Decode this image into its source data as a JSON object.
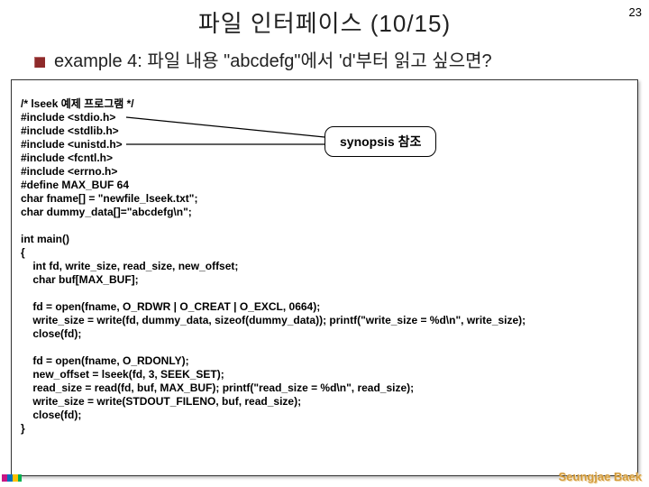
{
  "page": {
    "title": "파일 인터페이스 (10/15)",
    "number": "23",
    "subtitle": "example 4: 파일 내용 \"abcdefg\"에서 'd'부터 읽고 싶으면?"
  },
  "code": {
    "block1": "/* lseek 예제 프로그램 */\n#include <stdio.h>\n#include <stdlib.h>\n#include <unistd.h>\n#include <fcntl.h>\n#include <errno.h>\n#define MAX_BUF 64\nchar fname[] = \"newfile_lseek.txt\";\nchar dummy_data[]=\"abcdefg\\n\";",
    "block2": "int main()\n{\n    int fd, write_size, read_size, new_offset;\n    char buf[MAX_BUF];",
    "block3": "    fd = open(fname, O_RDWR | O_CREAT | O_EXCL, 0664);\n    write_size = write(fd, dummy_data, sizeof(dummy_data)); printf(\"write_size = %d\\n\", write_size);\n    close(fd);",
    "block4": "    fd = open(fname, O_RDONLY);\n    new_offset = lseek(fd, 3, SEEK_SET);\n    read_size = read(fd, buf, MAX_BUF); printf(\"read_size = %d\\n\", read_size);\n    write_size = write(STDOUT_FILENO, buf, read_size);\n    close(fd);\n}"
  },
  "callout": {
    "text": "synopsis 참조"
  },
  "footer": {
    "author": "Seungjae Baek"
  }
}
